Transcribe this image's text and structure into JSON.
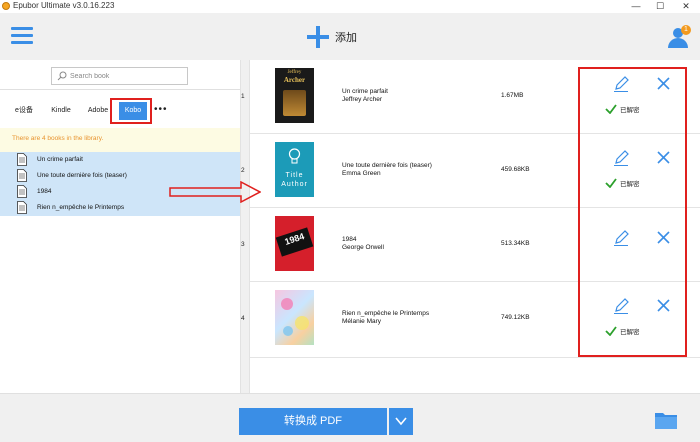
{
  "window": {
    "title": "Epubor Ultimate v3.0.16.223"
  },
  "toolbar": {
    "add_label": "添加",
    "user_badge": "1"
  },
  "colors": {
    "accent": "#3a8ee6",
    "highlight": "#e0201e",
    "info": "#e8932e",
    "badge": "#f39a1e"
  },
  "left": {
    "search": {
      "placeholder": "Search book"
    },
    "tabs": [
      {
        "label": "e设备"
      },
      {
        "label": "Kindle"
      },
      {
        "label": "Adobe"
      },
      {
        "label": "Kobo",
        "active": true
      }
    ],
    "more_label": "•••",
    "info": "There are 4 books in the library.",
    "list": [
      {
        "title": "Un crime parfait"
      },
      {
        "title": "Une toute dernière fois (teaser)"
      },
      {
        "title": "1984"
      },
      {
        "title": "Rien n_empêche le Printemps"
      }
    ]
  },
  "books": [
    {
      "index": "1",
      "title": "Un crime parfait",
      "author": "Jeffrey Archer",
      "size": "1.67MB",
      "decrypted": true,
      "cover_text_1": "Jeffrey",
      "cover_text_2": "Archer"
    },
    {
      "index": "2",
      "title": "Une toute dernière fois (teaser)",
      "author": "Emma Green",
      "size": "459.68KB",
      "decrypted": true,
      "cover_text_1": "Title",
      "cover_text_2": "Author"
    },
    {
      "index": "3",
      "title": "1984",
      "author": "George Orwell",
      "size": "513.34KB",
      "decrypted": false,
      "cover_text_1": "1984",
      "cover_text_2": ""
    },
    {
      "index": "4",
      "title": "Rien n_empêche le Printemps",
      "author": "Mélanie Mary",
      "size": "749.12KB",
      "decrypted": true,
      "cover_text_1": "",
      "cover_text_2": ""
    }
  ],
  "decrypted_label": "已解密",
  "bottom": {
    "convert_label": "转换成 PDF"
  }
}
